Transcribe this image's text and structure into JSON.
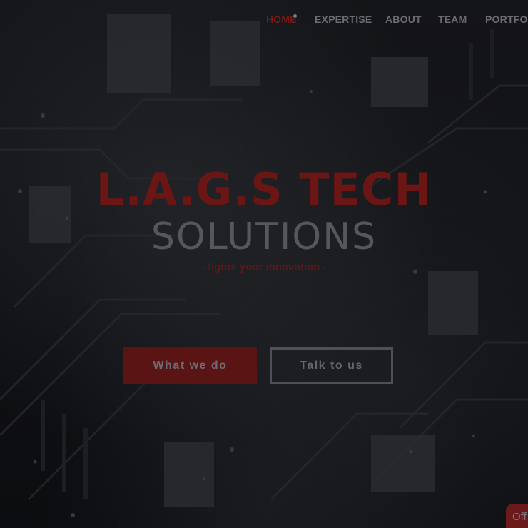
{
  "nav": {
    "items": [
      {
        "label": "HOME",
        "active": true
      },
      {
        "label": "EXPERTISE",
        "active": false
      },
      {
        "label": "ABOUT",
        "active": false
      },
      {
        "label": "TEAM",
        "active": false
      },
      {
        "label": "PORTFOL",
        "active": false
      }
    ]
  },
  "hero": {
    "title": "L.A.G.S TECH",
    "subtitle": "SOLUTIONS",
    "tagline": "- lights your innovation -",
    "primary_button": "What we do",
    "secondary_button": "Talk to us"
  },
  "chat_widget": {
    "label": "Off"
  },
  "colors": {
    "accent": "#6b1515",
    "background": "#0e0f12",
    "muted_text": "#56575c"
  }
}
